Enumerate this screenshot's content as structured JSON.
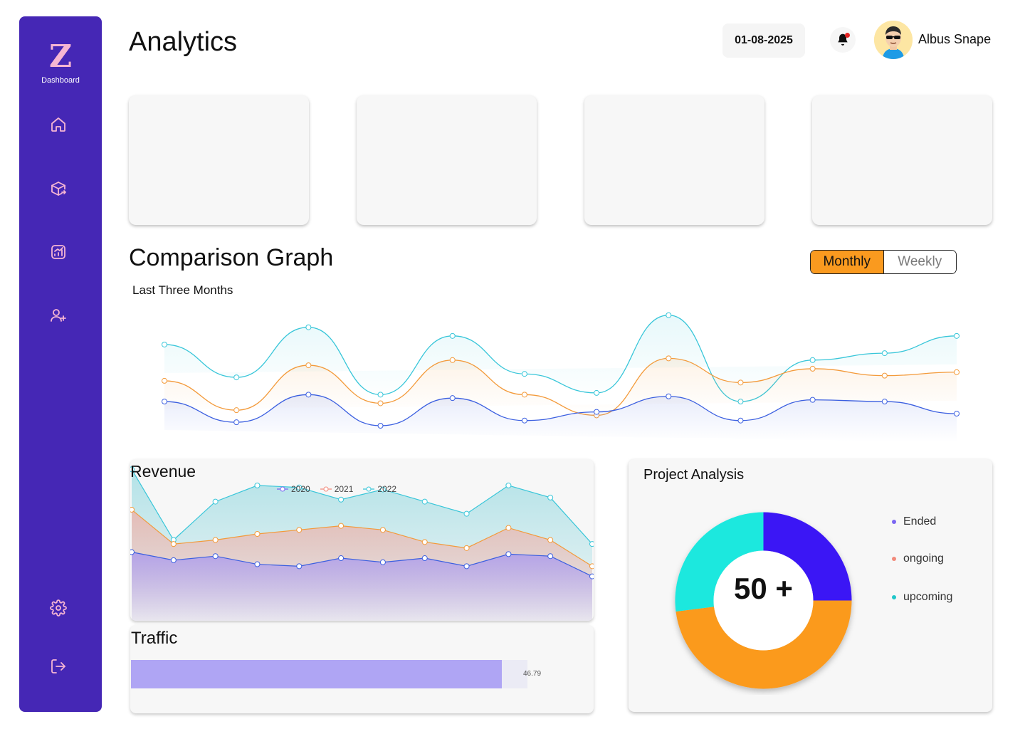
{
  "sidebar": {
    "logo_letter": "Z",
    "logo_label": "Dashboard",
    "items": [
      {
        "icon": "home-icon"
      },
      {
        "icon": "box-icon"
      },
      {
        "icon": "chart-icon"
      },
      {
        "icon": "add-user-icon"
      },
      {
        "icon": "gear-icon"
      },
      {
        "icon": "logout-icon"
      }
    ]
  },
  "header": {
    "title": "Analytics",
    "date": "01-08-2025",
    "user_name": "Albus Snape"
  },
  "comparison": {
    "title": "Comparison Graph",
    "subtitle": "Last Three Months",
    "toggle": {
      "active": "Monthly",
      "inactive": "Weekly"
    }
  },
  "revenue": {
    "title": "Revenue",
    "legend": [
      "2020",
      "2021",
      "2022"
    ]
  },
  "traffic": {
    "title": "Traffic",
    "value": "46.79",
    "fill_fraction": 0.935
  },
  "project_analysis": {
    "title": "Project Analysis",
    "center_label": "50 +",
    "legend": [
      {
        "label": "Ended",
        "color": "#7b66f2"
      },
      {
        "label": "ongoing",
        "color": "#f28a7b"
      },
      {
        "label": "upcoming",
        "color": "#1fc6c9"
      }
    ]
  },
  "colors": {
    "sidebar": "#4527b5",
    "accent": "#fa9a1f",
    "series_2020": "#3b5fe0",
    "series_2021": "#f39a3a",
    "series_2022": "#38c6d9"
  },
  "chart_data": [
    {
      "type": "line",
      "series": [
        {
          "values": [
            69,
            50,
            79,
            40,
            74,
            52,
            41,
            86,
            36,
            60,
            64,
            74
          ]
        },
        {
          "values": [
            48,
            31,
            57,
            35,
            60,
            40,
            28,
            61,
            47,
            55,
            51,
            53
          ]
        },
        {
          "values": [
            36,
            24,
            40,
            22,
            38,
            25,
            30,
            39,
            25,
            37,
            36,
            29
          ]
        }
      ]
    },
    {
      "type": "area",
      "series": [
        {
          "name": "2020",
          "values": [
            34,
            30,
            32,
            28,
            27,
            31,
            29,
            31,
            27,
            33,
            32,
            22
          ]
        },
        {
          "name": "2021",
          "values": [
            55,
            38,
            40,
            43,
            45,
            47,
            45,
            39,
            36,
            46,
            40,
            27
          ]
        },
        {
          "name": "2022",
          "values": [
            75,
            40,
            59,
            67,
            66,
            60,
            65,
            59,
            53,
            67,
            61,
            38
          ]
        }
      ],
      "ylim": [
        0,
        80
      ]
    },
    {
      "type": "pie",
      "slices": [
        {
          "label": "Ended",
          "value": 25,
          "color": "#3a12f5"
        },
        {
          "label": "ongoing",
          "value": 48,
          "color": "#fb9a1f"
        },
        {
          "label": "upcoming",
          "value": 27,
          "color": "#1ae8de"
        }
      ]
    }
  ]
}
